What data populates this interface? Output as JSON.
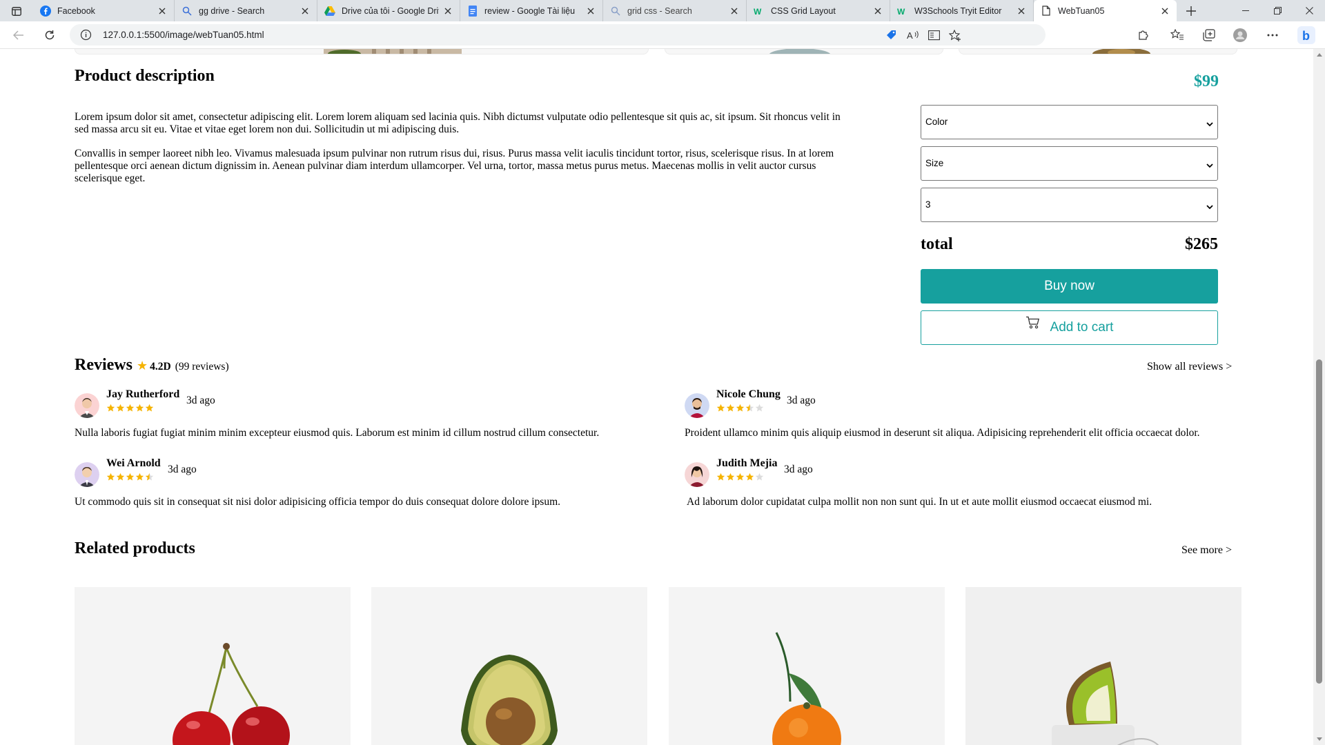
{
  "browser": {
    "tabs": [
      {
        "label": "Facebook",
        "icon": "facebook-icon"
      },
      {
        "label": "gg drive - Search",
        "icon": "search-icon"
      },
      {
        "label": "Drive của tôi - Google Drive",
        "icon": "google-drive-icon"
      },
      {
        "label": "review - Google Tài liệu",
        "icon": "google-docs-icon"
      },
      {
        "label": "grid css - Search",
        "icon": "search-icon"
      },
      {
        "label": "CSS Grid Layout",
        "icon": "w3schools-icon"
      },
      {
        "label": "W3Schools Tryit Editor",
        "icon": "w3schools-icon"
      },
      {
        "label": "WebTuan05",
        "icon": "page-icon"
      }
    ],
    "url": "127.0.0.1:5500/image/webTuan05.html"
  },
  "product": {
    "description_title": "Product description",
    "price": "$99",
    "paragraphs": [
      "Lorem ipsum dolor sit amet, consectetur adipiscing elit. Lorem lorem aliquam sed lacinia quis. Nibh dictumst vulputate odio pellentesque sit quis ac, sit ipsum. Sit rhoncus velit in sed massa arcu sit eu. Vitae et vitae eget lorem non dui. Sollicitudin ut mi adipiscing duis.",
      "Convallis in semper laoreet nibh leo. Vivamus malesuada ipsum pulvinar non rutrum risus dui, risus. Purus massa velit iaculis tincidunt tortor, risus, scelerisque risus. In at lorem pellentesque orci aenean dictum dignissim in. Aenean pulvinar diam interdum ullamcorper. Vel urna, tortor, massa metus purus metus. Maecenas mollis in velit auctor cursus scelerisque eget."
    ],
    "color_select": "Color",
    "size_select": "Size",
    "quantity_select": "3",
    "total_label": "total",
    "total_value": "$265",
    "buy_label": "Buy now",
    "cart_label": "Add to cart",
    "accent_color": "#16a09e"
  },
  "reviews": {
    "title": "Reviews",
    "score": "4.2D",
    "count": "(99 reviews)",
    "show_all": "Show all reviews >",
    "items": [
      {
        "name": "Jay Rutherford",
        "ago": "3d ago",
        "rating": 5,
        "text": "Nulla laboris fugiat fugiat minim minim excepteur eiusmod quis. Laborum est minim id cillum nostrud cillum consectetur."
      },
      {
        "name": "Nicole Chung",
        "ago": "3d ago",
        "rating": 3.5,
        "text": "Proident ullamco minim quis aliquip eiusmod in deserunt sit aliqua. Adipisicing reprehenderit elit officia occaecat dolor."
      },
      {
        "name": "Wei Arnold",
        "ago": "3d ago",
        "rating": 4.5,
        "text": "Ut commodo quis sit in consequat sit nisi dolor adipisicing officia tempor do duis consequat dolore dolore ipsum."
      },
      {
        "name": "Judith Mejia",
        "ago": "3d ago",
        "rating": 4,
        "text": "Ad laborum dolor cupidatat culpa mollit non non sunt qui. In ut et aute mollit eiusmod occaecat eiusmod mi."
      }
    ]
  },
  "related": {
    "title": "Related products",
    "see_more": "See more >",
    "products": [
      "cherry",
      "avocado",
      "orange",
      "kiwi"
    ]
  }
}
